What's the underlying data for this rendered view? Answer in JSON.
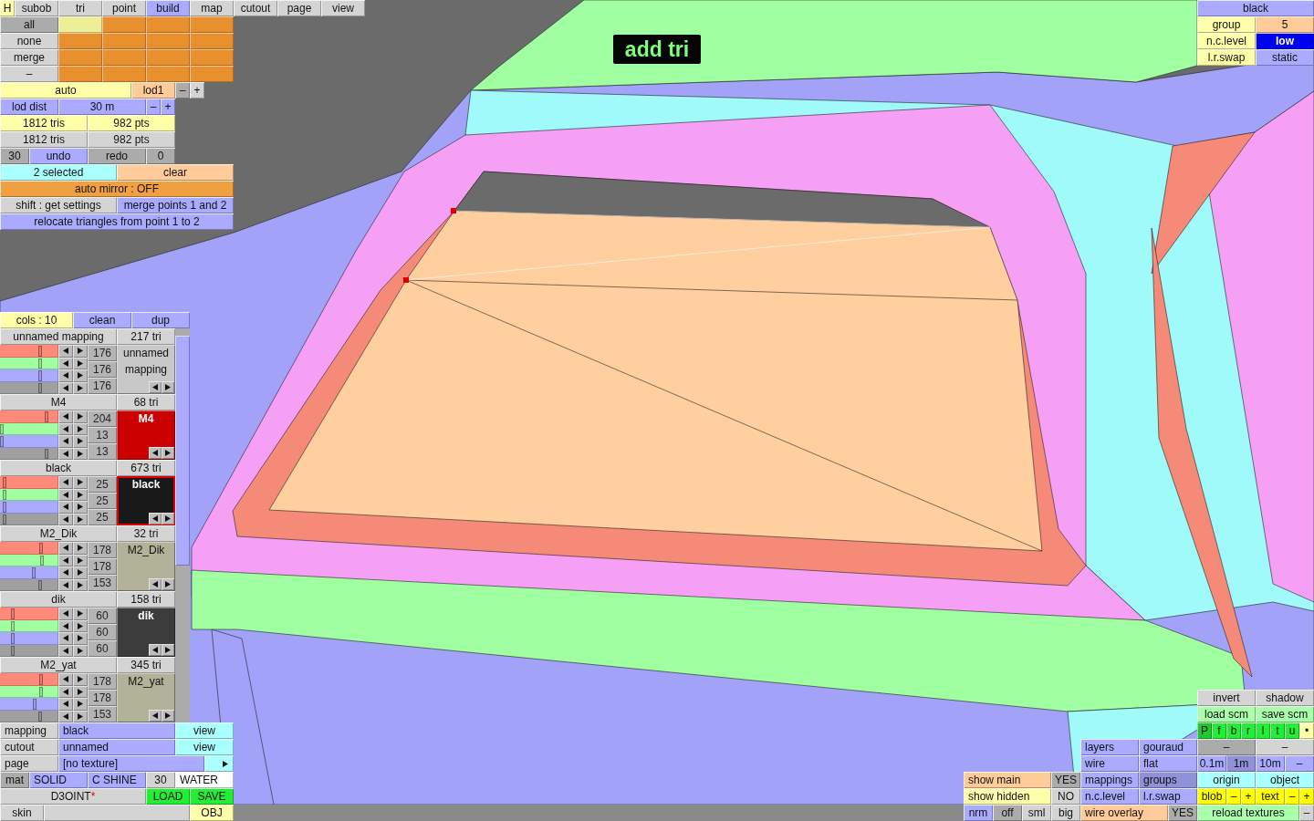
{
  "mode_label": "add tri",
  "tool_panel": {
    "help_button": {
      "label": "H"
    },
    "tabs": [
      {
        "label": "subob",
        "selected": false
      },
      {
        "label": "tri",
        "selected": false
      },
      {
        "label": "point",
        "selected": false
      },
      {
        "label": "build",
        "selected": true
      },
      {
        "label": "map",
        "selected": false
      },
      {
        "label": "cutout",
        "selected": false
      },
      {
        "label": "page",
        "selected": false
      },
      {
        "label": "view",
        "selected": false
      }
    ],
    "select_buttons": [
      {
        "label": "all",
        "kind": "dark"
      },
      {
        "label": "none",
        "kind": "grey"
      },
      {
        "label": "merge",
        "kind": "grey"
      },
      {
        "label": "–",
        "kind": "grey"
      }
    ],
    "swatches": [
      [
        {
          "selected": true
        },
        {
          "selected": false
        },
        {
          "selected": false
        },
        {
          "selected": false
        }
      ],
      [
        {
          "selected": false
        },
        {
          "selected": false
        },
        {
          "selected": false
        },
        {
          "selected": false
        }
      ],
      [
        {
          "selected": false
        },
        {
          "selected": false
        },
        {
          "selected": false
        },
        {
          "selected": false
        }
      ],
      [
        {
          "selected": false
        },
        {
          "selected": false
        },
        {
          "selected": false
        },
        {
          "selected": false
        }
      ]
    ],
    "lod_rows": [
      [
        {
          "label": "auto",
          "kind": "yellow"
        },
        {
          "label": "lod1",
          "kind": "peach"
        },
        {
          "label": "–",
          "kind": "dark"
        },
        {
          "label": "+",
          "kind": "grey"
        }
      ],
      [
        {
          "label": "lod dist",
          "kind": "blue"
        },
        {
          "label": "30 m",
          "kind": "blue"
        },
        {
          "label": "–",
          "kind": "blue"
        },
        {
          "label": "+",
          "kind": "blue"
        }
      ]
    ],
    "count_rows": [
      [
        {
          "label": "1812 tris",
          "kind": "yellow"
        },
        {
          "label": "982 pts",
          "kind": "yellow"
        }
      ],
      [
        {
          "label": "1812 tris",
          "kind": "grey"
        },
        {
          "label": "982 pts",
          "kind": "grey"
        }
      ]
    ],
    "history": [
      {
        "label": "30",
        "kind": "dark"
      },
      {
        "label": "undo",
        "kind": "blue"
      },
      {
        "label": "redo",
        "kind": "dark"
      },
      {
        "label": "0",
        "kind": "dark"
      }
    ],
    "rows": [
      [
        {
          "label": "2 selected",
          "kind": "cyan"
        },
        {
          "label": "clear",
          "kind": "peach"
        }
      ],
      [
        {
          "label": "auto mirror : OFF",
          "kind": "orange"
        }
      ],
      [
        {
          "label": "shift : get settings",
          "kind": "grey"
        },
        {
          "label": "merge points 1 and 2",
          "kind": "blue"
        }
      ],
      [
        {
          "label": "relocate triangles from point 1 to 2",
          "kind": "blue"
        }
      ]
    ]
  },
  "group_panel": [
    [
      {
        "label": "black",
        "kind": "blue"
      }
    ],
    [
      {
        "label": "group",
        "kind": "yellow"
      },
      {
        "label": "5",
        "kind": "peach"
      }
    ],
    [
      {
        "label": "n.c.level",
        "kind": "yellow"
      },
      {
        "label": "low",
        "kind": "navy"
      }
    ],
    [
      {
        "label": "l.r.swap",
        "kind": "yellow"
      },
      {
        "label": "static",
        "kind": "blue"
      }
    ]
  ],
  "mapping_panel": {
    "header": [
      {
        "label": "cols : 10",
        "kind": "yellow"
      },
      {
        "label": "clean",
        "kind": "blue"
      },
      {
        "label": "dup",
        "kind": "blue"
      }
    ],
    "mappings": [
      {
        "name": "unnamed mapping",
        "tris": "217 tri",
        "sliders": [
          {
            "level": 0.69
          },
          {
            "level": 0.69
          },
          {
            "level": 0.69
          },
          {
            "level": 0.68
          }
        ],
        "values": [
          "176",
          "176",
          "176"
        ],
        "preview": "unnamed mapping",
        "color": "#c8c8c8",
        "selected": false
      },
      {
        "name": "M4",
        "tris": "68 tri",
        "sliders": [
          {
            "level": 0.8
          },
          {
            "level": 0.03
          },
          {
            "level": 0.03
          },
          {
            "level": 0.8
          }
        ],
        "values": [
          "204",
          "13",
          "13"
        ],
        "preview": "M4",
        "color": "#cc0000",
        "selected": false
      },
      {
        "name": "black",
        "tris": "673 tri",
        "sliders": [
          {
            "level": 0.08
          },
          {
            "level": 0.08
          },
          {
            "level": 0.08
          },
          {
            "level": 0.08
          }
        ],
        "values": [
          "25",
          "25",
          "25"
        ],
        "preview": "black",
        "color": "#191919",
        "selected": true
      },
      {
        "name": "M2_Dik",
        "tris": "32 tri",
        "sliders": [
          {
            "level": 0.7
          },
          {
            "level": 0.72
          },
          {
            "level": 0.58
          },
          {
            "level": 0.68
          }
        ],
        "values": [
          "178",
          "178",
          "153"
        ],
        "preview": "M2_Dik",
        "color": "#b2b299",
        "selected": false
      },
      {
        "name": "dik",
        "tris": "158 tri",
        "sliders": [
          {
            "level": 0.22
          },
          {
            "level": 0.22
          },
          {
            "level": 0.22
          },
          {
            "level": 0.22
          }
        ],
        "values": [
          "60",
          "60",
          "60"
        ],
        "preview": "dik",
        "color": "#3c3c3c",
        "selected": false
      },
      {
        "name": "M2_yat",
        "tris": "345 tri",
        "sliders": [
          {
            "level": 0.7
          },
          {
            "level": 0.7
          },
          {
            "level": 0.6
          },
          {
            "level": 0.68
          }
        ],
        "values": [
          "178",
          "178",
          "153"
        ],
        "preview": "M2_yat",
        "color": "#b2b299",
        "selected": false
      }
    ],
    "footer": [
      [
        {
          "label": "mapping",
          "kind": "grey"
        },
        {
          "label": "black",
          "kind": "blue"
        },
        {
          "label": "view",
          "kind": "cyan"
        }
      ],
      [
        {
          "label": "cutout",
          "kind": "grey"
        },
        {
          "label": "unnamed",
          "kind": "blue"
        },
        {
          "label": "view",
          "kind": "cyan"
        }
      ],
      [
        {
          "label": "page",
          "kind": "grey"
        },
        {
          "label": "[no texture]",
          "kind": "blue"
        },
        {
          "kind": "cyan"
        }
      ],
      [
        {
          "label": "mat",
          "kind": "dark"
        },
        {
          "label": "SOLID",
          "kind": "blue"
        },
        {
          "label": "C SHINE",
          "kind": "blue"
        },
        {
          "label": "30",
          "kind": "grey"
        },
        {
          "label": "WATER",
          "kind": "white"
        }
      ],
      [
        {
          "label": "D3OINT",
          "mark": "*",
          "kind": "grey"
        },
        {
          "label": "LOAD",
          "kind": "green"
        },
        {
          "label": "SAVE",
          "kind": "green"
        }
      ],
      [
        {
          "label": "skin",
          "kind": "grey"
        },
        {
          "kind": "grey"
        },
        {
          "label": "OBJ",
          "kind": "yellow"
        }
      ]
    ]
  },
  "show_panel": [
    [
      {
        "label": "show main",
        "kind": "peach"
      },
      {
        "label": "YES",
        "kind": "dark"
      }
    ],
    [
      {
        "label": "show hidden",
        "kind": "yellow"
      },
      {
        "label": "NO",
        "kind": "grey"
      }
    ],
    [
      {
        "label": "nrm",
        "kind": "blue"
      },
      {
        "label": "off",
        "kind": "dark"
      },
      {
        "label": "sml",
        "kind": "grey"
      },
      {
        "label": "big",
        "kind": "grey"
      }
    ]
  ],
  "display_panel": [
    [
      {
        "label": "layers",
        "kind": "blue"
      },
      {
        "label": "gouraud",
        "kind": "blue"
      }
    ],
    [
      {
        "label": "wire",
        "kind": "blue"
      },
      {
        "label": "flat",
        "kind": "blue"
      }
    ],
    [
      {
        "label": "mappings",
        "kind": "blue",
        "selected": false
      },
      {
        "label": "groups",
        "kind": "blue",
        "selected": true
      }
    ],
    [
      {
        "label": "n.c.level",
        "kind": "blue"
      },
      {
        "label": "l.r.swap",
        "kind": "blue"
      }
    ],
    [
      {
        "label": "wire overlay",
        "kind": "peach"
      },
      {
        "label": "YES",
        "kind": "dark"
      }
    ]
  ],
  "view_panel": [
    [
      {
        "label": "invert",
        "kind": "grey"
      },
      {
        "label": "shadow",
        "kind": "grey"
      }
    ],
    [
      {
        "label": "load scm",
        "kind": "mint"
      },
      {
        "label": "save scm",
        "kind": "mint"
      }
    ],
    [
      {
        "label": "P",
        "kind": "green",
        "selected": true
      },
      {
        "label": "f",
        "kind": "green",
        "selected": false
      },
      {
        "label": "b",
        "kind": "green",
        "selected": false
      },
      {
        "label": "r",
        "kind": "green",
        "selected": false
      },
      {
        "label": "l",
        "kind": "green",
        "selected": false
      },
      {
        "label": "t",
        "kind": "green",
        "selected": false
      },
      {
        "label": "u",
        "kind": "green",
        "selected": false
      },
      {
        "label": "•",
        "kind": "yellow",
        "selected": false
      }
    ],
    [
      {
        "label": "–",
        "kind": "dark"
      },
      {
        "label": "–",
        "kind": "grey"
      }
    ],
    [
      {
        "label": "0.1m",
        "kind": "blue",
        "selected": false
      },
      {
        "label": "1m",
        "kind": "blue",
        "selected": true
      },
      {
        "label": "10m",
        "kind": "blue",
        "selected": false
      },
      {
        "label": "–",
        "kind": "blue",
        "selected": false
      }
    ],
    [
      {
        "label": "origin",
        "kind": "cyan"
      },
      {
        "label": "object",
        "kind": "cyan"
      }
    ],
    [
      {
        "label": "blob",
        "kind": "lemon"
      },
      {
        "label": "–",
        "kind": "lemon"
      },
      {
        "label": "+",
        "kind": "lemon"
      },
      {
        "label": "text",
        "kind": "lemon"
      },
      {
        "label": "–",
        "kind": "lemon"
      },
      {
        "label": "+",
        "kind": "lemon"
      }
    ],
    [
      {
        "label": "reload textures",
        "kind": "mint"
      },
      {
        "label": "–",
        "kind": "grey"
      }
    ]
  ]
}
